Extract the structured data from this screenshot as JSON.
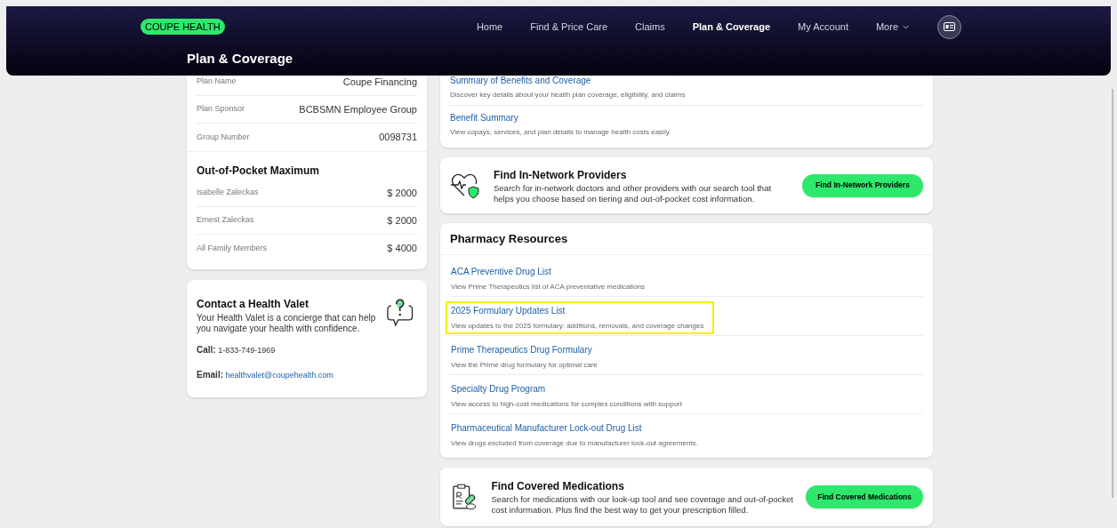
{
  "header": {
    "logo": "COUPE HEALTH",
    "page_title": "Plan & Coverage",
    "nav": [
      {
        "label": "Home",
        "selected": false,
        "kind": "link"
      },
      {
        "label": "Find & Price Care",
        "selected": false,
        "kind": "link"
      },
      {
        "label": "Claims",
        "selected": false,
        "kind": "link"
      },
      {
        "label": "Plan & Coverage",
        "selected": true,
        "kind": "link"
      },
      {
        "label": "My Account",
        "selected": false,
        "kind": "link"
      },
      {
        "label": "More",
        "selected": false,
        "kind": "dropdown"
      }
    ]
  },
  "plan_details": [
    {
      "label": "Plan Name",
      "value": "Coupe Financing"
    },
    {
      "label": "Plan Sponsor",
      "value": "BCBSMN Employee Group"
    },
    {
      "label": "Group Number",
      "value": "0098731"
    }
  ],
  "out_of_pocket": {
    "title": "Out-of-Pocket Maximum",
    "rows": [
      {
        "label": "Isabelle Zaleckas",
        "value": "$ 2000"
      },
      {
        "label": "Ernest Zaleckas",
        "value": "$ 2000"
      },
      {
        "label": "All Family Members",
        "value": "$ 4000"
      }
    ]
  },
  "contact": {
    "title": "Contact a Health Valet",
    "text": "Your Health Valet is a concierge that can help you navigate your health with confidence.",
    "call_label": "Call:",
    "call_value": "1-833-749-1969",
    "email_label": "Email:",
    "email_value": "healthvalet@coupehealth.com"
  },
  "plan_documents": [
    {
      "title": "Summary of Benefits and Coverage",
      "description": "Discover key details about your health plan coverage, eligibility, and claims"
    },
    {
      "title": "Benefit Summary",
      "description": "View copays, services, and plan details to manage health costs easily."
    }
  ],
  "providers": {
    "title": "Find In-Network Providers",
    "text": "Search for in-network doctors and other providers with our search tool that helps you choose based on tiering and out-of-pocket cost information.",
    "button": "Find In-Network Providers"
  },
  "pharmacy": {
    "title": "Pharmacy Resources",
    "items": [
      {
        "title": "ACA Preventive Drug List",
        "description": "View Prime Therapeutics list of ACA preventative medications",
        "highlighted": false
      },
      {
        "title": "2025 Formulary Updates List",
        "description": "View updates to the 2025 formulary: additions, removals, and coverage changes",
        "highlighted": true
      },
      {
        "title": "Prime Therapeutics Drug Formulary",
        "description": "View the Prime drug formulary for optimal care",
        "highlighted": false
      },
      {
        "title": "Specialty Drug Program",
        "description": "View access to high-cost medications for complex conditions with support",
        "highlighted": false
      },
      {
        "title": "Pharmaceutical Manufacturer Lock-out Drug List",
        "description": "View drugs excluded from coverage due to manufacturer lock-out agreements.",
        "highlighted": false
      }
    ]
  },
  "medications": {
    "title": "Find Covered Medications",
    "text": "Search for medications with our look-up tool and see coverage and out-of-pocket cost information. Plus find the best way to get your prescription filled.",
    "button": "Find Covered Medications"
  }
}
